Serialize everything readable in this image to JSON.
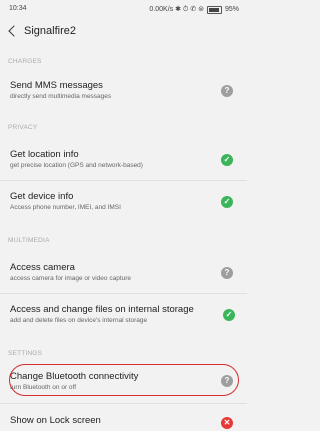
{
  "status_bar": {
    "time": "10:34",
    "right_text": "0.00K/s ✱ ⏱ ✆ ⊜",
    "battery": "95%",
    "battery_level": 0.95
  },
  "header": {
    "title": "Signalfire2"
  },
  "sections": {
    "charges": "CHARGES",
    "privacy": "PRIVACY",
    "multimedia": "MULTIMEDIA",
    "settings": "SETTINGS"
  },
  "items": {
    "send_mms": {
      "title": "Send MMS messages",
      "subtitle": "directly send multimedia messages",
      "status": "unknown"
    },
    "location": {
      "title": "Get location info",
      "subtitle": "get precise location (GPS and network-based)",
      "status": "granted"
    },
    "device": {
      "title": "Get device info",
      "subtitle": "Access phone number, IMEI, and IMSI",
      "status": "granted"
    },
    "camera": {
      "title": "Access camera",
      "subtitle": "access camera for image or video capture",
      "status": "unknown"
    },
    "storage": {
      "title": "Access and change files on internal storage",
      "subtitle": "add and delete files on device's internal storage",
      "status": "granted"
    },
    "bluetooth": {
      "title": "Change Bluetooth connectivity",
      "subtitle": "turn Bluetooth on or off",
      "status": "unknown"
    },
    "lock_screen": {
      "title": "Show on Lock screen",
      "status": "denied"
    }
  },
  "icons": {
    "unknown": "?",
    "granted": "✓",
    "denied": "✕"
  },
  "colors": {
    "granted": "#3cb55a",
    "unknown": "#9e9e9e",
    "denied": "#e53935",
    "highlight": "#d32f2f"
  }
}
